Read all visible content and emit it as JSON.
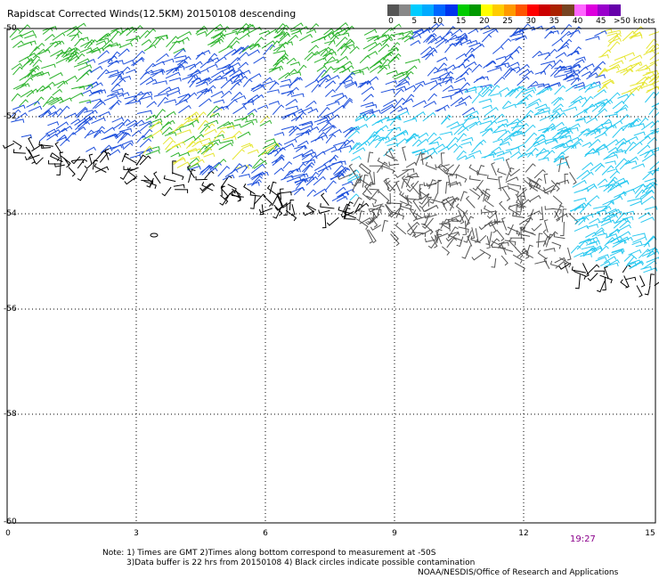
{
  "title": "Rapidscat Corrected Winds(12.5KM) 20150108 descending",
  "scale": {
    "colors": [
      "#555555",
      "#888888",
      "#00ccff",
      "#00aaff",
      "#0066ff",
      "#0033ee",
      "#00cc00",
      "#009900",
      "#ffff00",
      "#ffcc00",
      "#ff9900",
      "#ff5500",
      "#ff0000",
      "#cc0000",
      "#aa2200",
      "#774422",
      "#ff66ff",
      "#dd00dd",
      "#9900cc",
      "#6600aa"
    ],
    "labels": [
      "0",
      "5",
      "10",
      "15",
      "20",
      "25",
      "30",
      "35",
      "40",
      "45",
      ">50 knots"
    ]
  },
  "lat_labels": [
    "-50",
    "-52",
    "-54",
    "-56",
    "-58",
    "-60"
  ],
  "lon_labels": [
    "0",
    "3",
    "6",
    "9",
    "12",
    "15"
  ],
  "time_label": "19:27",
  "notes": [
    "Note: 1) Times are GMT 2)Times along bottom correspond to measurement at -50S",
    "3)Data buffer is 22 hrs from 20150108 4) Black circles indicate possible contamination",
    "NOAA/NESDIS/Office of Research and Applications"
  ],
  "map_data": {
    "lat_range": [
      -60,
      -50
    ],
    "lon_range": [
      0,
      15
    ],
    "swath_regions": [
      {
        "name": "north-green",
        "color": "#2db32d"
      },
      {
        "name": "yellow",
        "color": "#e6e632"
      },
      {
        "name": "blue",
        "color": "#1e50dc"
      },
      {
        "name": "cyan",
        "color": "#28c8f0"
      },
      {
        "name": "black-edge",
        "color": "#000000"
      },
      {
        "name": "gray",
        "color": "#555555"
      }
    ]
  }
}
